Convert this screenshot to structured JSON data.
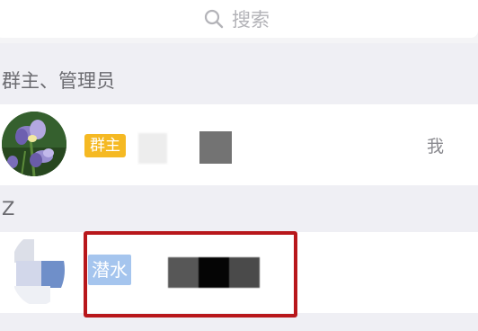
{
  "search": {
    "placeholder": "搜索",
    "icon": "search-icon"
  },
  "sections": {
    "admins_header": "群主、管理员",
    "z_header": "Z"
  },
  "members": [
    {
      "role_badge": "群主",
      "badge_color": "#f5b923",
      "suffix": "我",
      "avatar": "iris-flower-avatar"
    },
    {
      "role_badge": "潜水",
      "badge_color": "#a5c5ee",
      "avatar": "blurred-avatar"
    }
  ],
  "colors": {
    "highlight": "#b8171b",
    "background": "#efeff4"
  }
}
